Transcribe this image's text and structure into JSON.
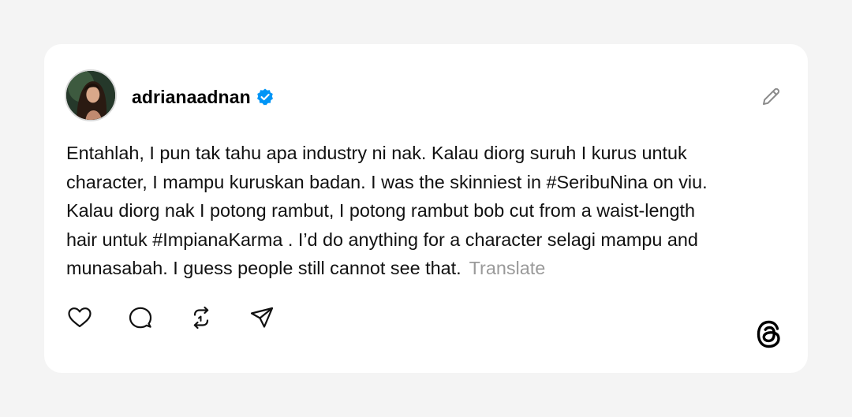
{
  "post": {
    "username": "adrianaadnan",
    "verified": true,
    "text_lines": [
      "Entahlah, I pun tak tahu apa industry ni nak. Kalau diorg suruh I kurus untuk",
      "character, I mampu kuruskan badan. I was the skinniest in #SeribuNina on viu.",
      "Kalau diorg nak I potong rambut, I potong rambut bob cut from a waist-length",
      "hair untuk #ImpianaKarma . I’d do anything for a character selagi mampu and",
      "munasabah. I guess people still cannot see that."
    ],
    "translate_label": "Translate"
  },
  "icons": {
    "avatar": "profile-photo",
    "verified": "verified-badge-icon",
    "edit": "pencil-icon",
    "like": "heart-icon",
    "reply": "comment-icon",
    "repost": "repost-icon",
    "share": "send-icon",
    "brand": "threads-logo-icon"
  },
  "colors": {
    "background": "#f4f4f4",
    "card": "#ffffff",
    "verified_blue": "#0095f6",
    "translate_gray": "#9a9a9a",
    "icon_gray": "#8a8a8a"
  }
}
